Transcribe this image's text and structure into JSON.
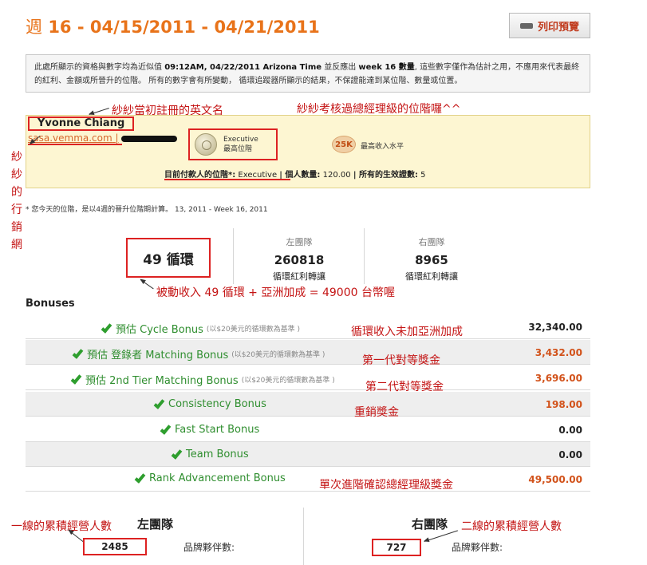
{
  "header": {
    "week_prefix": "週",
    "week_range": "16 - 04/15/2011 - 04/21/2011",
    "print_label": "列印預覽"
  },
  "notice": {
    "part1": "此處所顯示的資格與數字均為近似值 ",
    "time": "09:12AM, 04/22/2011 Arizona Time",
    "part2": " 並反應出 ",
    "week": "week 16 數量",
    "part3": ", 這些數字僅作為估計之用，不應用來代表最終的紅利、金額或所晉升的位階。 所有的數字會有所變動， 循環追蹤器所顯示的結果，不保證能達到某位階、數量或位置。"
  },
  "profile": {
    "name": "Yvonne Chiang",
    "site": "sasa.vemma.com",
    "site_sep": "|",
    "rank_title": "Executive",
    "rank_sub": "最高位階",
    "income_badge": "25K",
    "income_label": "最高收入水平",
    "status_label": "目前付款人的位階*:",
    "status_value": "Executive",
    "personal_label": "| 個人數量:",
    "personal_value": "120.00",
    "active_label": "| 所有的生效證數:",
    "active_value": "5"
  },
  "footnote": "* 您今天的位階，是以4週的晉升位階期計算。  13, 2011 - Week 16, 2011",
  "cycles": {
    "value": "49 循環",
    "left_label": "左團隊",
    "left_value": "260818",
    "left_sub": "循環紅利轉讓",
    "right_label": "右團隊",
    "right_value": "8965",
    "right_sub": "循環紅利轉讓"
  },
  "bonuses": {
    "title": "Bonuses",
    "rows": [
      {
        "label": "預估 Cycle Bonus",
        "note": "(以$20美元的循環數為基準 )",
        "amount": "32,340.00"
      },
      {
        "label": "預估 登錄者 Matching Bonus",
        "note": "(以$20美元的循環數為基準 )",
        "amount": "3,432.00"
      },
      {
        "label": "預估 2nd Tier Matching Bonus",
        "note": "(以$20美元的循環數為基準 )",
        "amount": "3,696.00"
      },
      {
        "label": "Consistency Bonus",
        "note": "",
        "amount": "198.00"
      },
      {
        "label": "Fast Start Bonus",
        "note": "",
        "amount": "0.00"
      },
      {
        "label": "Team Bonus",
        "note": "",
        "amount": "0.00"
      },
      {
        "label": "Rank Advancement Bonus",
        "note": "",
        "amount": "49,500.00"
      }
    ]
  },
  "annotations": {
    "english_name": "紗紗當初註冊的英文名",
    "rank_passed": "紗紗考核過總經理級的位階囉^^",
    "site_vertical": "紗紗的行銷網",
    "passive_income": "被動收入 49 循環 + 亞洲加成 = 49000 台幣喔",
    "cycle_note": "循環收入未加亞洲加成",
    "gen1": "第一代對等獎金",
    "gen2": "第二代對等獎金",
    "repeat": "重銷獎金",
    "rank_bonus": "單次進階確認總經理級獎金",
    "left_cumulative": "一線的累積經營人數",
    "right_cumulative": "二線的累積經營人數"
  },
  "bottom": {
    "left_title": "左團隊",
    "left_count": "2485",
    "left_label": "品牌夥伴數:",
    "right_title": "右團隊",
    "right_count": "727",
    "right_label": "品牌夥伴數:"
  }
}
